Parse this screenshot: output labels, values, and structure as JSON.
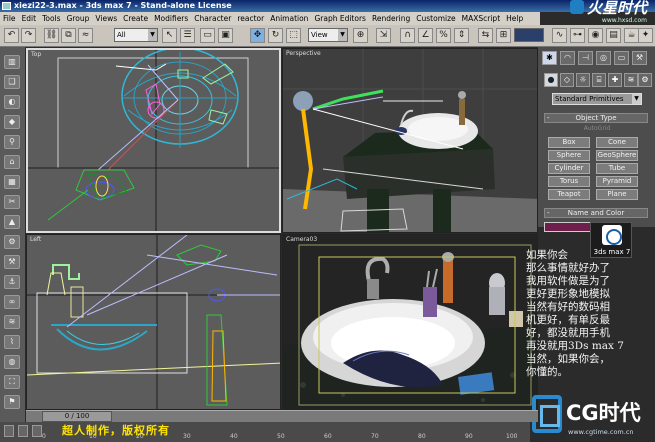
{
  "window": {
    "title": "xiezi22-3.max - 3ds max 7 - Stand-alone License"
  },
  "brand": {
    "name": "火星时代",
    "url": "www.hxsd.com"
  },
  "menu": [
    "File",
    "Edit",
    "Tools",
    "Group",
    "Views",
    "Create",
    "Modifiers",
    "Character",
    "reactor",
    "Animation",
    "Graph Editors",
    "Rendering",
    "Customize",
    "MAXScript",
    "Help"
  ],
  "toolbar": {
    "selection_filter": "All",
    "reference_coord": "View"
  },
  "viewports": {
    "top": "Top",
    "perspective": "Perspective",
    "left": "Left",
    "camera": "Camera03"
  },
  "command_panel": {
    "primitive_type": "Standard Primitives",
    "object_type_title": "Object Type",
    "autogrid": "AutoGrid",
    "buttons": [
      "Box",
      "Cone",
      "Sphere",
      "GeoSphere",
      "Cylinder",
      "Tube",
      "Torus",
      "Pyramid",
      "Teapot",
      "Plane"
    ],
    "name_color_title": "Name and Color"
  },
  "badge": {
    "label": "3ds max 7"
  },
  "commentary": [
    "如果你会",
    "那么事情就好办了",
    "我用软件做是为了",
    "更好更形象地模拟",
    "当然有好的数码相",
    "机更好，有单反最",
    "好，都没就用手机",
    "再没就用3Ds max 7",
    "当然，如果你会，",
    "你懂的。"
  ],
  "cg_logo": {
    "text": "CG时代",
    "url": "www.cgtime.com.cn"
  },
  "timeline": {
    "frame": "0 / 100",
    "ticks": [
      "0",
      "10",
      "20",
      "30",
      "40",
      "50",
      "60",
      "70",
      "80",
      "90",
      "100"
    ]
  },
  "credit": "超人制作，版权所有"
}
